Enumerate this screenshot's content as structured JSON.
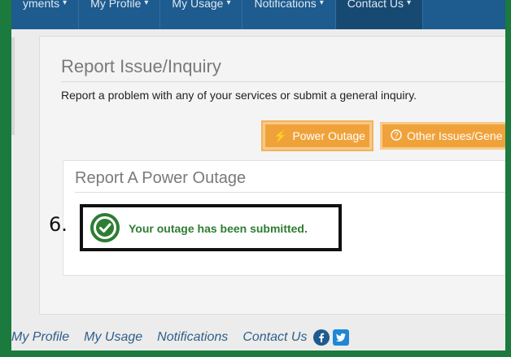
{
  "nav": {
    "items": [
      {
        "label": "yments",
        "caret": "▾"
      },
      {
        "label": "My Profile",
        "caret": "▾"
      },
      {
        "label": "My Usage",
        "caret": "▾"
      },
      {
        "label": "Notifications",
        "caret": "▾"
      },
      {
        "label": "Contact Us",
        "caret": "▾"
      }
    ]
  },
  "panel": {
    "title": "Report Issue/Inquiry",
    "description": "Report a problem with any of your services or submit a general inquiry.",
    "power_button": "Power Outage",
    "power_icon": "⚡",
    "other_button": "Other Issues/Gene",
    "other_icon": "?"
  },
  "card": {
    "title": "Report A Power Outage"
  },
  "step_label": "6.",
  "success_message": "Your outage has been submitted.",
  "footer": {
    "links": [
      "My Profile",
      "My Usage",
      "Notifications",
      "Contact Us"
    ]
  },
  "colors": {
    "frame_green": "#1b7a3e",
    "nav_blue": "#1e5b8e",
    "button_orange": "#f0a23a",
    "success_green": "#2e7d32",
    "footer_link": "#2f5f8a"
  }
}
